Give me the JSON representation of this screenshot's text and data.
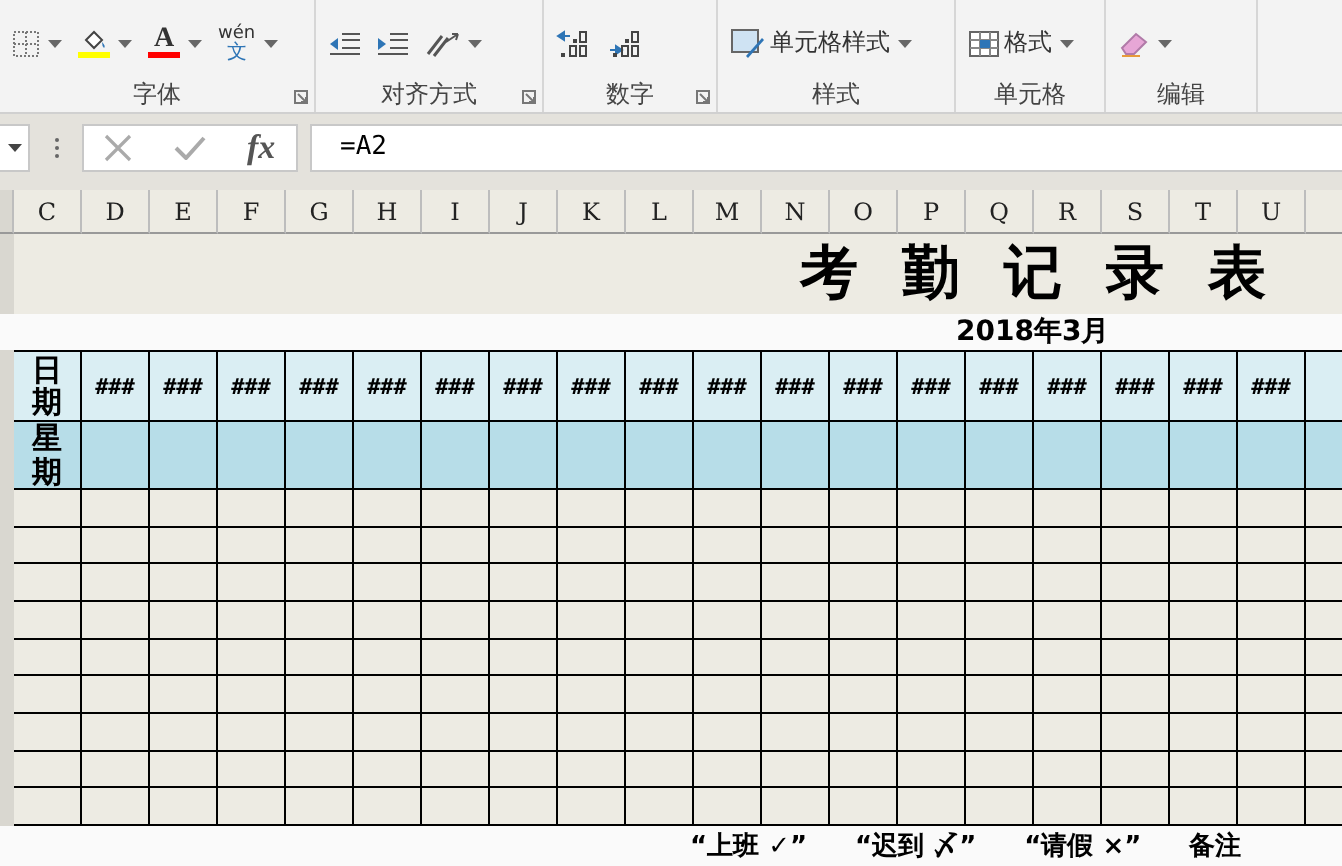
{
  "ribbon": {
    "groups": [
      {
        "label": "字体",
        "launcher": true,
        "controls": [
          {
            "kind": "borders"
          },
          {
            "kind": "fill_color",
            "color": "#ffff00"
          },
          {
            "kind": "font_color",
            "text": "A",
            "color": "#ff0000"
          },
          {
            "kind": "phonetic",
            "ruby": "wén",
            "text": "文"
          }
        ]
      },
      {
        "label": "对齐方式",
        "launcher": true,
        "controls": [
          {
            "kind": "indent_decrease"
          },
          {
            "kind": "indent_increase"
          },
          {
            "kind": "orientation"
          }
        ]
      },
      {
        "label": "数字",
        "launcher": true,
        "controls": [
          {
            "kind": "decimal_increase"
          },
          {
            "kind": "decimal_decrease"
          }
        ]
      },
      {
        "label": "样式",
        "controls": [
          {
            "kind": "cell_styles",
            "text": "单元格样式"
          }
        ]
      },
      {
        "label": "单元格",
        "controls": [
          {
            "kind": "format",
            "text": "格式"
          }
        ]
      },
      {
        "label": "编辑",
        "controls": [
          {
            "kind": "clear"
          }
        ]
      }
    ]
  },
  "formula_bar": {
    "fx": "fx",
    "formula": "=A2"
  },
  "columns": [
    "C",
    "D",
    "E",
    "F",
    "G",
    "H",
    "I",
    "J",
    "K",
    "L",
    "M",
    "N",
    "O",
    "P",
    "Q",
    "R",
    "S",
    "T",
    "U"
  ],
  "sheet": {
    "title": "考勤记录表",
    "month": "2018年3月",
    "date_label": "日期",
    "weekday_label": "星期",
    "dates": [
      "###",
      "###",
      "###",
      "###",
      "###",
      "###",
      "###",
      "###",
      "###",
      "###",
      "###",
      "###",
      "###",
      "###",
      "###",
      "###",
      "###",
      "###"
    ],
    "legend": [
      "“上班 ✓”",
      "“迟到 〆”",
      "“请假 ×”",
      "备注"
    ]
  }
}
